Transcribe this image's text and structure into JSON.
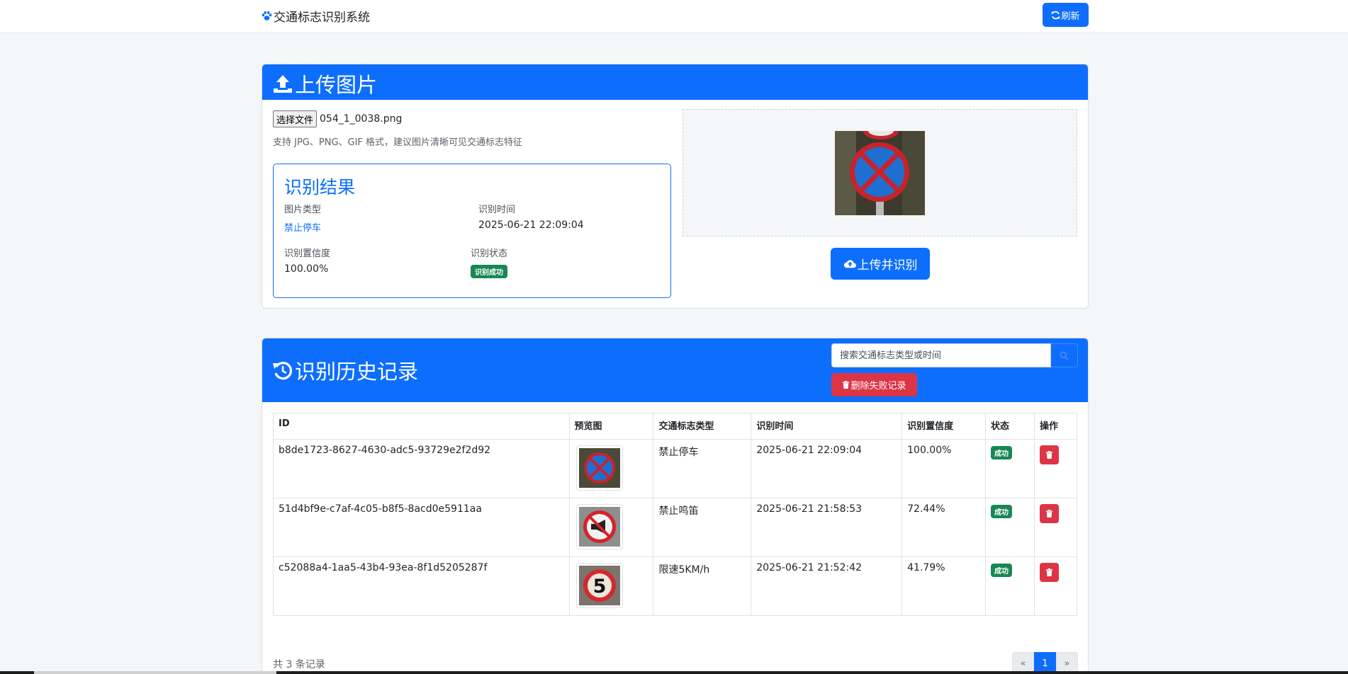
{
  "navbar": {
    "brand": "交通标志识别系统",
    "refresh_label": "刷新"
  },
  "upload": {
    "title": "上传图片",
    "choose_file_label": "选择文件",
    "file_name": "054_1_0038.png",
    "hint": "支持 JPG、PNG、GIF 格式，建议图片清晰可见交通标志特征",
    "result": {
      "title": "识别结果",
      "type_label": "图片类型",
      "type_value": "禁止停车",
      "time_label": "识别时间",
      "time_value": "2025-06-21 22:09:04",
      "confidence_label": "识别置信度",
      "confidence_value": "100.00%",
      "status_label": "识别状态",
      "status_value": "识别成功"
    },
    "upload_button_label": "上传并识别"
  },
  "history": {
    "title": "识别历史记录",
    "search_placeholder": "搜索交通标志类型或时间",
    "delete_failed_label": "删除失败记录",
    "columns": [
      "ID",
      "预览图",
      "交通标志类型",
      "识别时间",
      "识别置信度",
      "状态",
      "操作"
    ],
    "rows": [
      {
        "id": "b8de1723-8627-4630-adc5-93729e2f2d92",
        "preview_icon": "no-parking-sign",
        "type": "禁止停车",
        "time": "2025-06-21 22:09:04",
        "confidence": "100.00%",
        "status": "成功"
      },
      {
        "id": "51d4bf9e-c7af-4c05-b8f5-8acd0e5911aa",
        "preview_icon": "no-horn-sign",
        "type": "禁止鸣笛",
        "time": "2025-06-21 21:58:53",
        "confidence": "72.44%",
        "status": "成功"
      },
      {
        "id": "c52088a4-1aa5-43b4-93ea-8f1d5205287f",
        "preview_icon": "speed-limit-5-sign",
        "type": "限速5KM/h",
        "time": "2025-06-21 21:52:42",
        "confidence": "41.79%",
        "status": "成功"
      }
    ],
    "total_text": "共 3 条记录",
    "pagination": {
      "prev": "«",
      "current": "1",
      "next": "»"
    }
  },
  "colors": {
    "primary": "#0d6efd",
    "danger": "#dc3545",
    "success": "#198754"
  }
}
